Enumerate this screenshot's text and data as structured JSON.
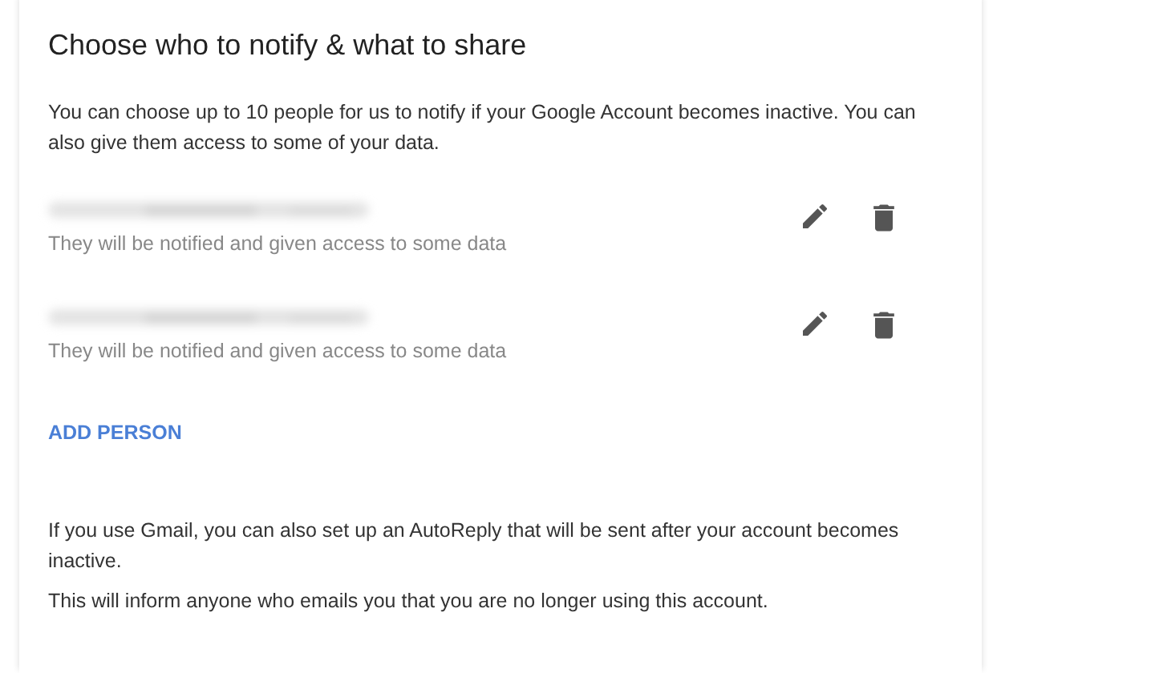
{
  "title": "Choose who to notify & what to share",
  "intro": "You can choose up to 10 people for us to notify if your Google Account becomes inactive. You can also give them access to some of your data.",
  "contacts": [
    {
      "subtitle": "They will be notified and given access to some data"
    },
    {
      "subtitle": "They will be notified and given access to some data"
    }
  ],
  "add_button": "ADD PERSON",
  "footer": [
    "If you use Gmail, you can also set up an AutoReply that will be sent after your account becomes inactive.",
    "This will inform anyone who emails you that you are no longer using this account."
  ]
}
